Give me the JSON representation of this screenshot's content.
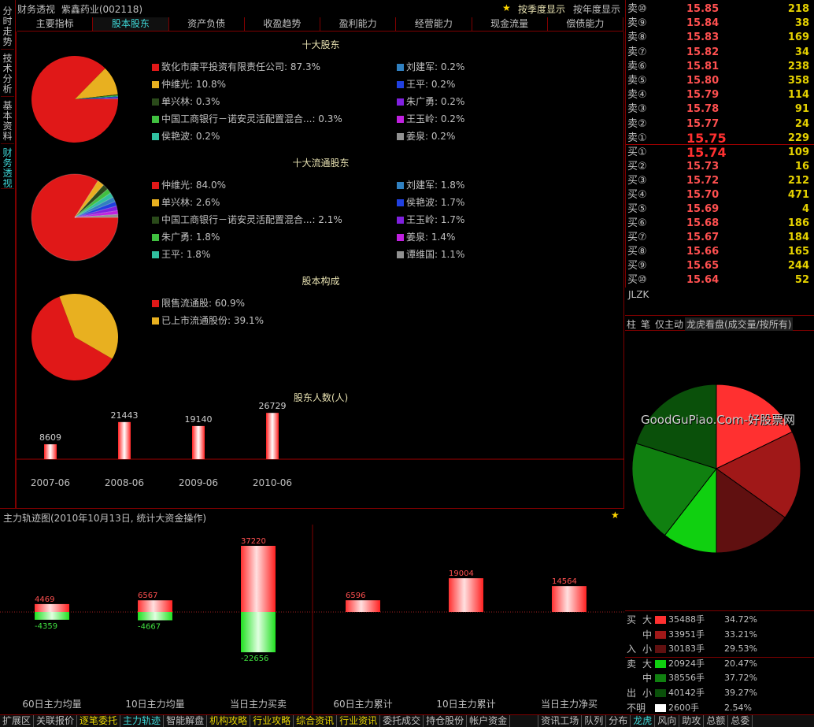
{
  "vtabs": [
    {
      "label": "分时走势",
      "active": false
    },
    {
      "label": "技术分析",
      "active": false
    },
    {
      "label": "基本资料",
      "active": false
    },
    {
      "label": "财务透视",
      "active": true
    }
  ],
  "title": {
    "name": "财务透视",
    "stock": "紫鑫药业(002118)",
    "quarter_btn": "按季度显示",
    "year_btn": "按年度显示"
  },
  "tabs": [
    {
      "label": "主要指标",
      "active": false
    },
    {
      "label": "股本股东",
      "active": true
    },
    {
      "label": "资产负债",
      "active": false
    },
    {
      "label": "收盈趋势",
      "active": false
    },
    {
      "label": "盈利能力",
      "active": false
    },
    {
      "label": "经营能力",
      "active": false
    },
    {
      "label": "现金流量",
      "active": false
    },
    {
      "label": "偿债能力",
      "active": false
    }
  ],
  "top10": {
    "title": "十大股东",
    "left": [
      {
        "text": "致化市康平投资有限责任公司: 87.3%",
        "color": "#e01818"
      },
      {
        "text": "仲维光: 10.8%",
        "color": "#e8b020"
      },
      {
        "text": "单兴林: 0.3%",
        "color": "#2a4a1a"
      },
      {
        "text": "中国工商银行－诺安灵活配置混合...: 0.3%",
        "color": "#40c040"
      },
      {
        "text": "侯艳波: 0.2%",
        "color": "#30c0a0"
      }
    ],
    "right": [
      {
        "text": "刘建军: 0.2%",
        "color": "#3080c0"
      },
      {
        "text": "王平: 0.2%",
        "color": "#2040e0"
      },
      {
        "text": "朱广勇: 0.2%",
        "color": "#8020e0"
      },
      {
        "text": "王玉岭: 0.2%",
        "color": "#c020e0"
      },
      {
        "text": "姜泉: 0.2%",
        "color": "#909090"
      }
    ]
  },
  "top10float": {
    "title": "十大流通股东",
    "left": [
      {
        "text": "仲维光: 84.0%",
        "color": "#e01818"
      },
      {
        "text": "单兴林: 2.6%",
        "color": "#e8b020"
      },
      {
        "text": "中国工商银行－诺安灵活配置混合...: 2.1%",
        "color": "#2a4a1a"
      },
      {
        "text": "朱广勇: 1.8%",
        "color": "#40c040"
      },
      {
        "text": "王平: 1.8%",
        "color": "#30c0a0"
      }
    ],
    "right": [
      {
        "text": "刘建军: 1.8%",
        "color": "#3080c0"
      },
      {
        "text": "侯艳波: 1.7%",
        "color": "#2040e0"
      },
      {
        "text": "王玉岭: 1.7%",
        "color": "#8020e0"
      },
      {
        "text": "姜泉: 1.4%",
        "color": "#c020e0"
      },
      {
        "text": "谭维国: 1.1%",
        "color": "#909090"
      }
    ]
  },
  "structure": {
    "title": "股本构成",
    "items": [
      {
        "text": "限售流通股: 60.9%",
        "color": "#e01818"
      },
      {
        "text": "已上市流通股份: 39.1%",
        "color": "#e8b020"
      }
    ]
  },
  "holders": {
    "title": "股东人数(人)"
  },
  "main_force": {
    "title": "主力轨迹图(2010年10月13日, 统计大资金操作)"
  },
  "order_label": "JLZK",
  "order_book": {
    "sell": [
      {
        "label": "卖⑩",
        "price": "15.85",
        "vol": "218"
      },
      {
        "label": "卖⑨",
        "price": "15.84",
        "vol": "38"
      },
      {
        "label": "卖⑧",
        "price": "15.83",
        "vol": "169"
      },
      {
        "label": "卖⑦",
        "price": "15.82",
        "vol": "34"
      },
      {
        "label": "卖⑥",
        "price": "15.81",
        "vol": "238"
      },
      {
        "label": "卖⑤",
        "price": "15.80",
        "vol": "358"
      },
      {
        "label": "卖④",
        "price": "15.79",
        "vol": "114"
      },
      {
        "label": "卖③",
        "price": "15.78",
        "vol": "91"
      },
      {
        "label": "卖②",
        "price": "15.77",
        "vol": "24"
      },
      {
        "label": "卖①",
        "price": "15.75",
        "vol": "229"
      }
    ],
    "buy": [
      {
        "label": "买①",
        "price": "15.74",
        "vol": "109"
      },
      {
        "label": "买②",
        "price": "15.73",
        "vol": "16"
      },
      {
        "label": "买③",
        "price": "15.72",
        "vol": "212"
      },
      {
        "label": "买④",
        "price": "15.70",
        "vol": "471"
      },
      {
        "label": "买⑤",
        "price": "15.69",
        "vol": "4"
      },
      {
        "label": "买⑥",
        "price": "15.68",
        "vol": "186"
      },
      {
        "label": "买⑦",
        "price": "15.67",
        "vol": "184"
      },
      {
        "label": "买⑧",
        "price": "15.66",
        "vol": "165"
      },
      {
        "label": "买⑨",
        "price": "15.65",
        "vol": "244"
      },
      {
        "label": "买⑩",
        "price": "15.64",
        "vol": "52"
      }
    ]
  },
  "right_tabs": [
    "柱",
    "笔",
    "仅主动",
    "龙虎看盘(成交量/按所有)"
  ],
  "flow_stats": [
    {
      "side": "买",
      "size": "大",
      "value": "35488手",
      "pct": "34.72%",
      "color": "#ff3030"
    },
    {
      "side": "",
      "size": "中",
      "value": "33951手",
      "pct": "33.21%",
      "color": "#a01818"
    },
    {
      "side": "入",
      "size": "小",
      "value": "30183手",
      "pct": "29.53%",
      "color": "#601010"
    },
    {
      "side": "卖",
      "size": "大",
      "value": "20924手",
      "pct": "20.47%",
      "color": "#10d010"
    },
    {
      "side": "",
      "size": "中",
      "value": "38556手",
      "pct": "37.72%",
      "color": "#108010"
    },
    {
      "side": "出",
      "size": "小",
      "value": "40142手",
      "pct": "39.27%",
      "color": "#0a500a"
    },
    {
      "side": "不明",
      "size": "",
      "value": "2600手",
      "pct": "2.54%",
      "color": "#ffffff"
    }
  ],
  "watermark": "GoodGuPiao.Com-好股票网",
  "footer": {
    "left": [
      {
        "label": "扩展区",
        "style": ""
      },
      {
        "label": "关联报价",
        "style": ""
      },
      {
        "label": "逐笔委托",
        "style": "hl"
      },
      {
        "label": "主力轨迹",
        "style": "ac"
      },
      {
        "label": "智能解盘",
        "style": ""
      },
      {
        "label": "机构攻略",
        "style": "hl"
      },
      {
        "label": "行业攻略",
        "style": "hl"
      },
      {
        "label": "综合资讯",
        "style": "hl"
      },
      {
        "label": "行业资讯",
        "style": "hl"
      },
      {
        "label": "委托成交",
        "style": ""
      },
      {
        "label": "持仓股份",
        "style": ""
      },
      {
        "label": "帐户资金",
        "style": ""
      }
    ],
    "mid": "资讯工场",
    "right": [
      {
        "label": "队列",
        "style": ""
      },
      {
        "label": "分布",
        "style": ""
      },
      {
        "label": "龙虎",
        "style": "ac"
      },
      {
        "label": "风向",
        "style": ""
      },
      {
        "label": "助攻",
        "style": ""
      },
      {
        "label": "总额",
        "style": ""
      },
      {
        "label": "总委",
        "style": ""
      }
    ]
  },
  "chart_data": [
    {
      "type": "pie",
      "title": "十大股东",
      "labels": [
        "致化市康平投资有限责任公司",
        "仲维光",
        "单兴林",
        "中国工商银行－诺安灵活配置混合...",
        "侯艳波",
        "刘建军",
        "王平",
        "朱广勇",
        "王玉岭",
        "姜泉"
      ],
      "values": [
        87.3,
        10.8,
        0.3,
        0.3,
        0.2,
        0.2,
        0.2,
        0.2,
        0.2,
        0.2
      ]
    },
    {
      "type": "pie",
      "title": "十大流通股东",
      "labels": [
        "仲维光",
        "单兴林",
        "中国工商银行－诺安灵活配置混合...",
        "朱广勇",
        "王平",
        "刘建军",
        "侯艳波",
        "王玉岭",
        "姜泉",
        "谭维国"
      ],
      "values": [
        84.0,
        2.6,
        2.1,
        1.8,
        1.8,
        1.8,
        1.7,
        1.7,
        1.4,
        1.1
      ]
    },
    {
      "type": "pie",
      "title": "股本构成",
      "labels": [
        "限售流通股",
        "已上市流通股份"
      ],
      "values": [
        60.9,
        39.1
      ]
    },
    {
      "type": "bar",
      "title": "股东人数(人)",
      "categories": [
        "2007-06",
        "2008-06",
        "2009-06",
        "2010-06"
      ],
      "values": [
        8609,
        21443,
        19140,
        26729
      ]
    },
    {
      "type": "bar",
      "title": "主力轨迹图(2010年10月13日, 统计大资金操作)",
      "categories": [
        "60日主力均量",
        "10日主力均量",
        "当日主力买卖"
      ],
      "series": [
        {
          "values": [
            4469,
            6567,
            37220
          ]
        },
        {
          "values": [
            -4359,
            -4667,
            -22656
          ]
        }
      ]
    },
    {
      "type": "bar",
      "categories": [
        "60日主力累计",
        "10日主力累计",
        "当日主力净买"
      ],
      "values": [
        6596,
        19004,
        14564
      ]
    },
    {
      "type": "pie",
      "title": "龙虎看盘(成交量/按所有)",
      "labels": [
        "买大",
        "买中",
        "买小",
        "卖大",
        "卖中",
        "卖小"
      ],
      "values": [
        35488,
        33951,
        30183,
        20924,
        38556,
        40142
      ]
    }
  ]
}
